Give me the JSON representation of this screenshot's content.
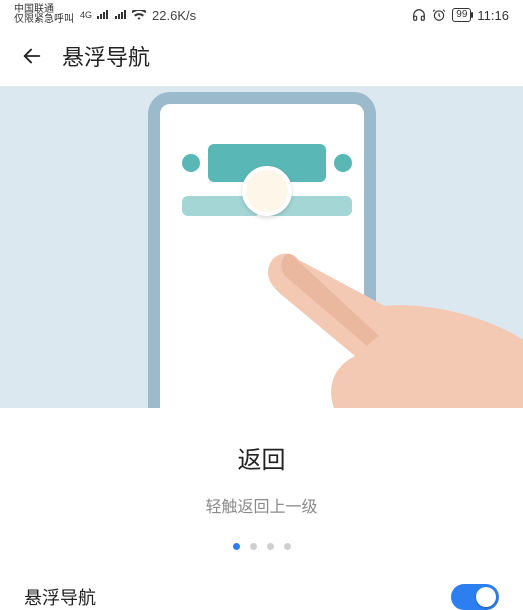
{
  "status": {
    "carrier": "中国联通",
    "subtext": "仅限紧急呼叫",
    "network": "4G",
    "speed": "22.6K/s",
    "battery": "99",
    "time": "11:16"
  },
  "header": {
    "title": "悬浮导航"
  },
  "caption": {
    "title": "返回",
    "subtitle": "轻触返回上一级"
  },
  "pager": {
    "count": 4,
    "active": 0
  },
  "setting": {
    "label": "悬浮导航",
    "enabled": true
  }
}
